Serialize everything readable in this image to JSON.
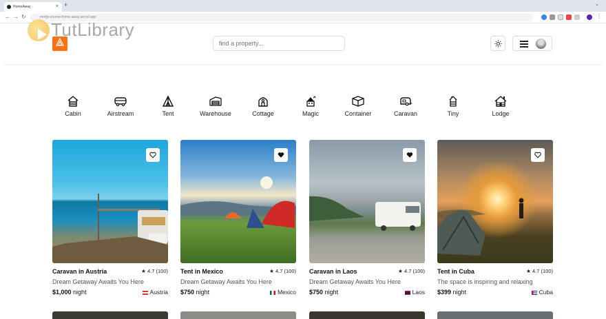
{
  "browser": {
    "tab_title": "HomeAway",
    "url": "nextjs-course-home-away.vercel.app"
  },
  "watermark": {
    "text": "TutLibrary"
  },
  "header": {
    "search_placeholder": "find a property..."
  },
  "categories": [
    {
      "label": "Cabin",
      "icon": "cabin-icon"
    },
    {
      "label": "Airstream",
      "icon": "airstream-icon"
    },
    {
      "label": "Tent",
      "icon": "tent-icon"
    },
    {
      "label": "Warehouse",
      "icon": "warehouse-icon"
    },
    {
      "label": "Cottage",
      "icon": "cottage-icon"
    },
    {
      "label": "Magic",
      "icon": "magic-icon"
    },
    {
      "label": "Container",
      "icon": "container-icon"
    },
    {
      "label": "Caravan",
      "icon": "caravan-icon"
    },
    {
      "label": "Tiny",
      "icon": "tiny-icon"
    },
    {
      "label": "Lodge",
      "icon": "lodge-icon"
    }
  ],
  "properties": [
    {
      "title": "Caravan in Austria",
      "rating": "4.7 (100)",
      "tagline": "Dream Getaway Awaits You Here",
      "price": "$1,000",
      "per": "night",
      "country": "Austria",
      "favorite": false
    },
    {
      "title": "Tent in Mexico",
      "rating": "4.7 (100)",
      "tagline": "Dream Getaway Awaits You Here",
      "price": "$750",
      "per": "night",
      "country": "Mexico",
      "favorite": true
    },
    {
      "title": "Caravan in Laos",
      "rating": "4.7 (100)",
      "tagline": "Dream Getaway Awaits You Here",
      "price": "$750",
      "per": "night",
      "country": "Laos",
      "favorite": true
    },
    {
      "title": "Tent in Cuba",
      "rating": "4.7 (100)",
      "tagline": "The space is inspiring and relaxing",
      "price": "$399",
      "per": "night",
      "country": "Cuba",
      "favorite": false
    }
  ],
  "colors": {
    "brand": "#f97316"
  }
}
